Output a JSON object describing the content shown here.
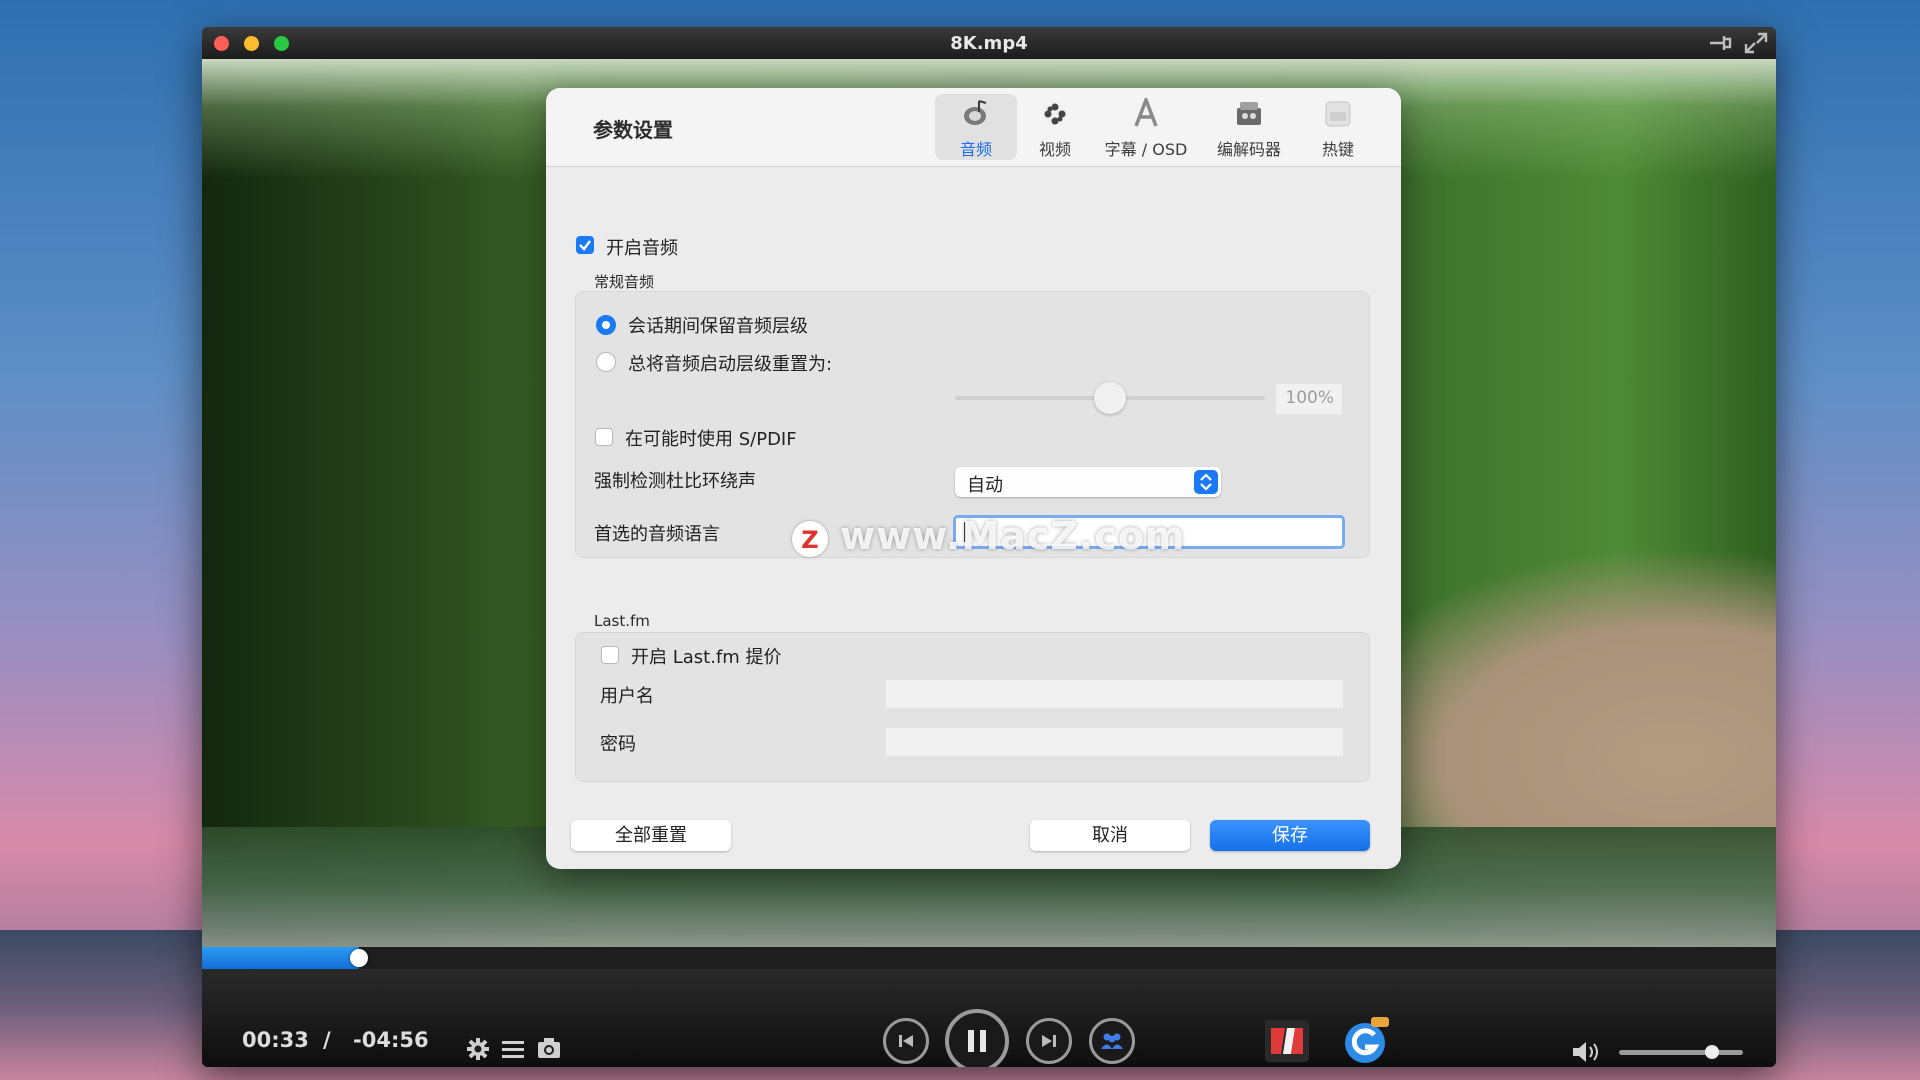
{
  "window": {
    "title": "8K.mp4"
  },
  "dialog": {
    "title": "参数设置",
    "tabs": [
      {
        "label": "音频",
        "icon": "audio-speaker-icon",
        "active": true
      },
      {
        "label": "视频",
        "icon": "film-reel-icon",
        "active": false
      },
      {
        "label": "字幕 / OSD",
        "icon": "subtitle-letter-icon",
        "active": false
      },
      {
        "label": "编解码器",
        "icon": "codec-box-icon",
        "active": false
      },
      {
        "label": "热键",
        "icon": "keyboard-icon",
        "active": false
      }
    ],
    "enable_audio": {
      "label": "开启音频",
      "checked": true
    },
    "general_audio": {
      "section_label": "常规音频",
      "keep_level_radio": {
        "label": "会话期间保留音频层级",
        "checked": true
      },
      "reset_level_radio": {
        "label": "总将音频启动层级重置为:",
        "checked": false
      },
      "level_slider": {
        "value": 100,
        "display": "100%"
      },
      "spdif": {
        "label": "在可能时使用 S/PDIF",
        "checked": false
      },
      "dolby": {
        "label": "强制检测杜比环绕声",
        "value": "自动"
      },
      "language": {
        "label": "首选的音频语言",
        "value": ""
      }
    },
    "lastfm": {
      "section_label": "Last.fm",
      "enable": {
        "label": "开启 Last.fm 提价",
        "checked": false
      },
      "username_label": "用户名",
      "password_label": "密码"
    },
    "buttons": {
      "reset_all": "全部重置",
      "cancel": "取消",
      "save": "保存"
    }
  },
  "watermark": {
    "text": "www.MacZ.com",
    "logo_letter": "Z"
  },
  "player": {
    "elapsed": "00:33",
    "separator": "/",
    "remaining": "-04:56",
    "progress_fraction": 0.1,
    "volume_fraction": 0.75
  },
  "colors": {
    "accent": "#1a7af5",
    "progress": "#2b9bf2"
  }
}
